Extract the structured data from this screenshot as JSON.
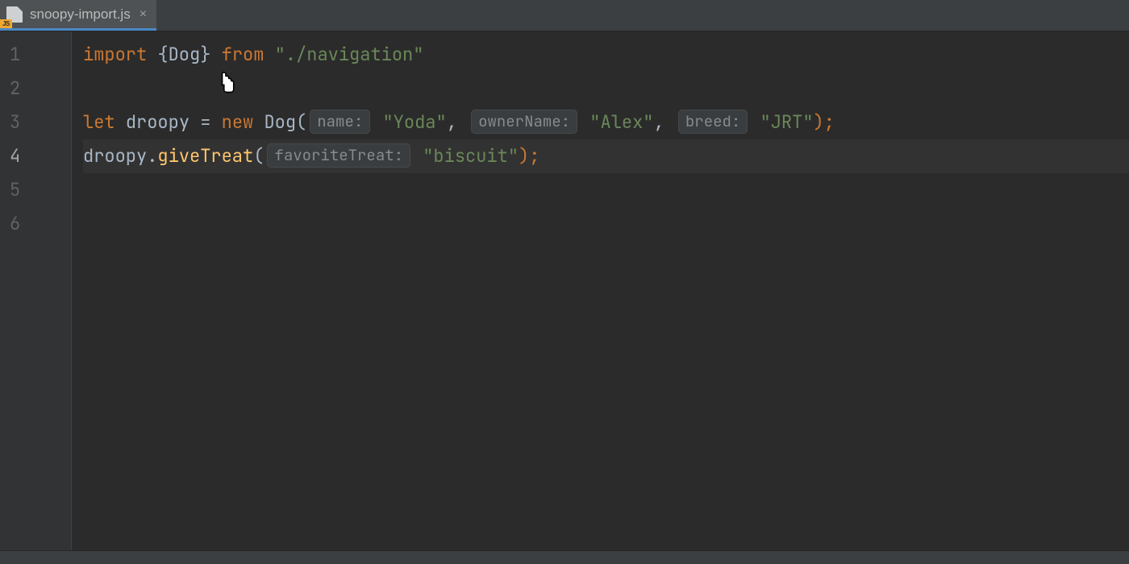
{
  "tab": {
    "filename": "snoopy-import.js",
    "js_badge": "JS"
  },
  "gutter": [
    "1",
    "2",
    "3",
    "4",
    "5",
    "6"
  ],
  "current_line_index": 3,
  "code": {
    "line1": {
      "import": "import",
      "open_brace": " {",
      "class_name": "Dog",
      "close_brace": "} ",
      "from": "from",
      "space": " ",
      "module": "\"./navigation\""
    },
    "line3": {
      "let": "let",
      "space1": " ",
      "var": "droopy",
      "eq": " = ",
      "new": "new",
      "space2": " ",
      "cls": "Dog",
      "open_paren": "(",
      "hint_name": "name:",
      "arg_name": " \"Yoda\"",
      "comma1": ", ",
      "hint_owner": "ownerName:",
      "arg_owner": " \"Alex\"",
      "comma2": ", ",
      "hint_breed": "breed:",
      "arg_breed": " \"JRT\"",
      "close": ");"
    },
    "line4": {
      "obj": "droopy",
      "dot": ".",
      "method": "giveTreat",
      "open_paren": "(",
      "hint_treat": "favoriteTreat:",
      "arg_treat": " \"biscuit\"",
      "close": ");"
    }
  }
}
